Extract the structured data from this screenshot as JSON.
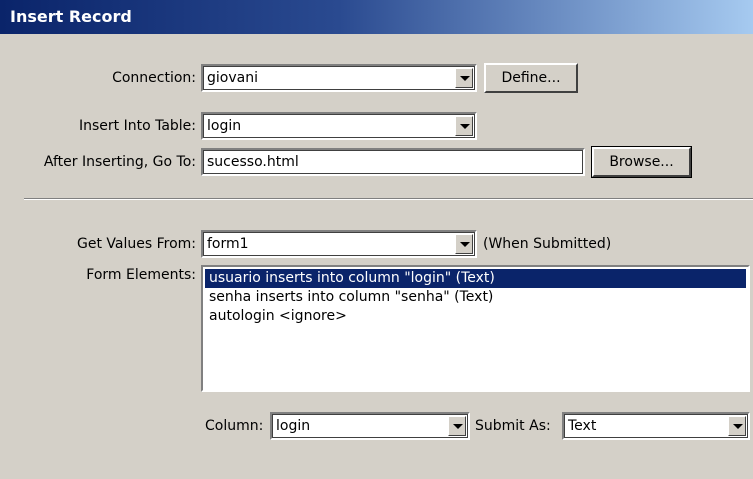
{
  "window": {
    "title": "Insert Record"
  },
  "connection": {
    "label": "Connection:",
    "value": "giovani",
    "define_label": "Define..."
  },
  "table": {
    "label": "Insert Into Table:",
    "value": "login"
  },
  "after_insert": {
    "label": "After Inserting, Go To:",
    "value": "sucesso.html",
    "browse_label": "Browse..."
  },
  "get_values": {
    "label": "Get Values From:",
    "value": "form1",
    "note": "(When Submitted)"
  },
  "form_elements": {
    "label": "Form Elements:",
    "items": [
      "usuario inserts into column \"login\" (Text)",
      "senha inserts into column \"senha\" (Text)",
      "autologin <ignore>"
    ],
    "selected_index": 0
  },
  "column": {
    "label": "Column:",
    "value": "login"
  },
  "submit_as": {
    "label": "Submit As:",
    "value": "Text"
  },
  "colors": {
    "dialog_bg": "#d4d0c8",
    "title_start": "#0a246a",
    "title_end": "#a6caf0",
    "selection": "#0a246a"
  }
}
